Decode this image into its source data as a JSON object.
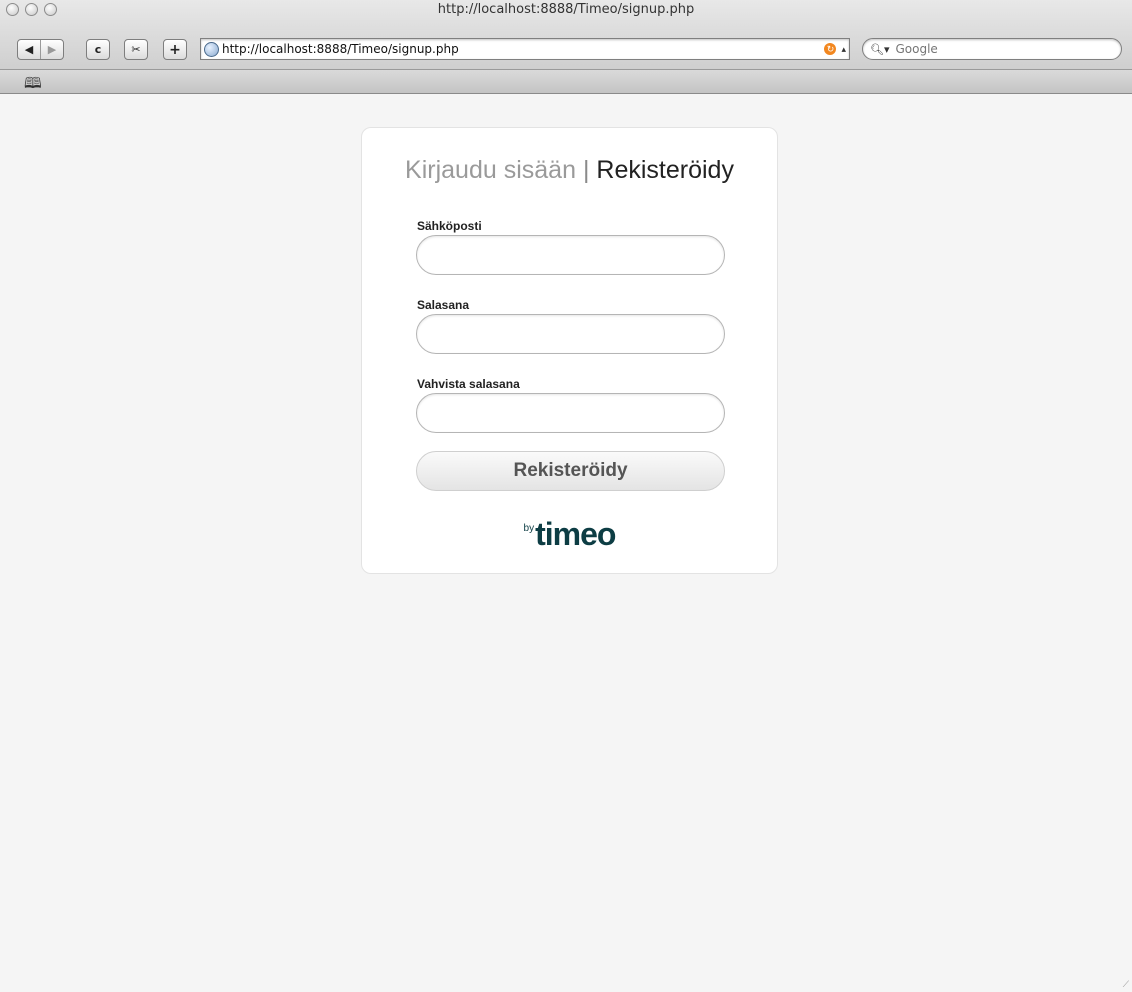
{
  "window": {
    "title": "http://localhost:8888/Timeo/signup.php"
  },
  "toolbar": {
    "back_label": "◀",
    "forward_label": "▶",
    "reload_label": "c",
    "snip_label": "✂",
    "add_label": "+",
    "url": "http://localhost:8888/Timeo/signup.php",
    "search_placeholder": "Google"
  },
  "page": {
    "tab_login": "Kirjaudu sisään",
    "tab_separator": "|",
    "tab_register": "Rekisteröidy",
    "email_label": "Sähköposti",
    "password_label": "Salasana",
    "confirm_label": "Vahvista salasana",
    "submit_label": "Rekisteröidy",
    "brand_by": "by",
    "brand_name": "timeo"
  },
  "colors": {
    "brand": "#0d3d44",
    "rss": "#f2871f"
  }
}
